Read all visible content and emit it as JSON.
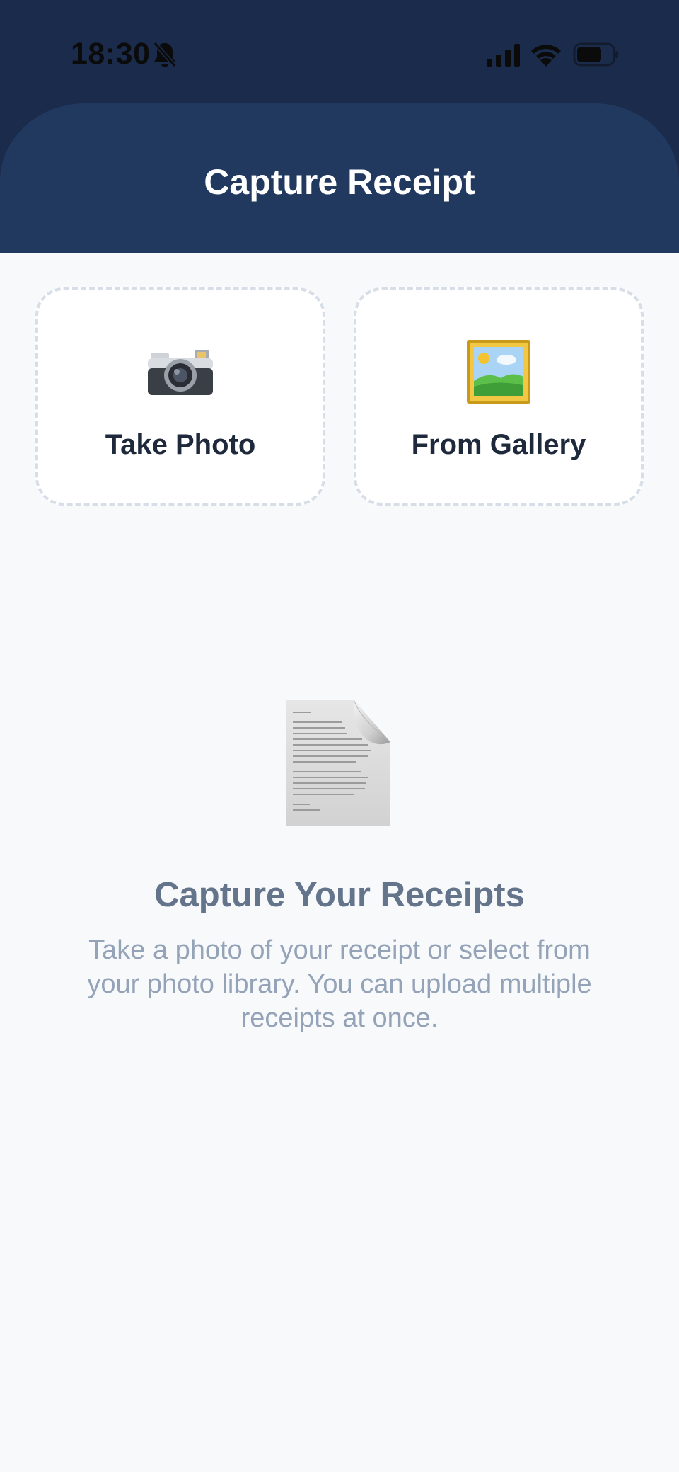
{
  "status_bar": {
    "time": "18:30",
    "icons": [
      "bell-off-icon",
      "signal-icon",
      "wifi-icon",
      "battery-icon"
    ]
  },
  "header": {
    "title": "Capture Receipt"
  },
  "actions": [
    {
      "label": "Take Photo",
      "icon": "camera-icon"
    },
    {
      "label": "From Gallery",
      "icon": "framed-picture-icon"
    }
  ],
  "empty_state": {
    "icon": "document-icon",
    "title": "Capture Your Receipts",
    "description": "Take a photo of your receipt or select from your photo library. You can upload multiple receipts at once."
  },
  "colors": {
    "status_bar_bg": "#1b2b4b",
    "header_bg": "#21385f",
    "page_bg": "#f7f9fb",
    "card_border": "#d7dee7",
    "card_label": "#1e293b",
    "empty_title": "#64748b",
    "empty_desc": "#94a3b8"
  }
}
